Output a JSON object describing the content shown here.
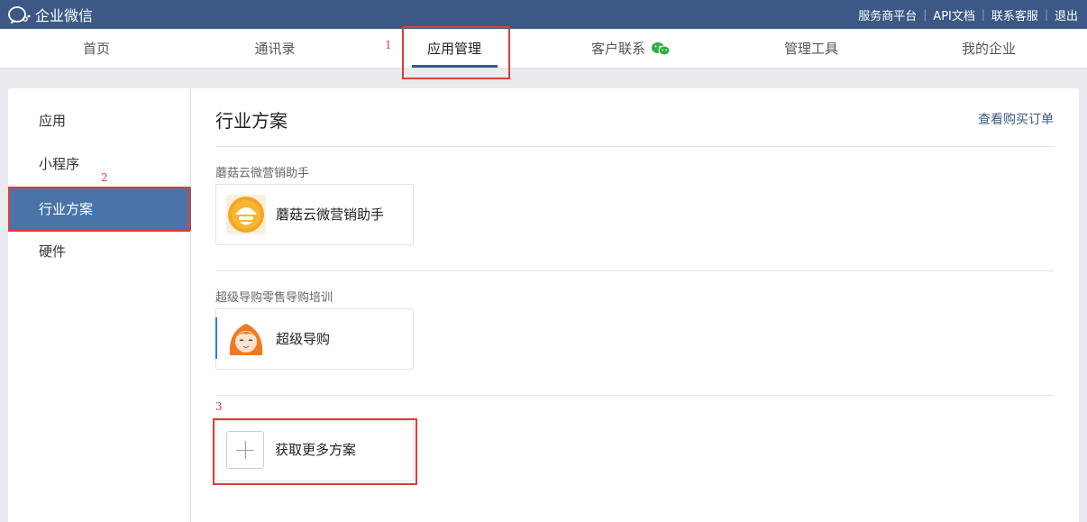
{
  "brand": {
    "name": "企业微信"
  },
  "top_links": [
    "服务商平台",
    "API文档",
    "联系客服",
    "退出"
  ],
  "nav": {
    "items": [
      "首页",
      "通讯录",
      "应用管理",
      "客户联系",
      "管理工具",
      "我的企业"
    ],
    "active": "应用管理"
  },
  "annotations": [
    "1",
    "2",
    "3"
  ],
  "sidebar": {
    "items": [
      "应用",
      "小程序",
      "行业方案",
      "硬件"
    ],
    "active": "行业方案"
  },
  "main": {
    "title": "行业方案",
    "orders_link": "查看购买订单",
    "sections": [
      {
        "title": "蘑菇云微营销助手",
        "app": {
          "name": "蘑菇云微营销助手",
          "icon": "mushroom-cloud-logo-icon"
        }
      },
      {
        "title": "超级导购零售导购培训",
        "app": {
          "name": "超级导购",
          "icon": "cartoon-girl-avatar-icon"
        }
      }
    ],
    "more": {
      "label": "获取更多方案",
      "icon": "plus-icon"
    }
  },
  "colors": {
    "topbar": "#3b5886",
    "accent": "#4a74a8",
    "annotation": "#e23b3b",
    "link": "#3b5886"
  }
}
